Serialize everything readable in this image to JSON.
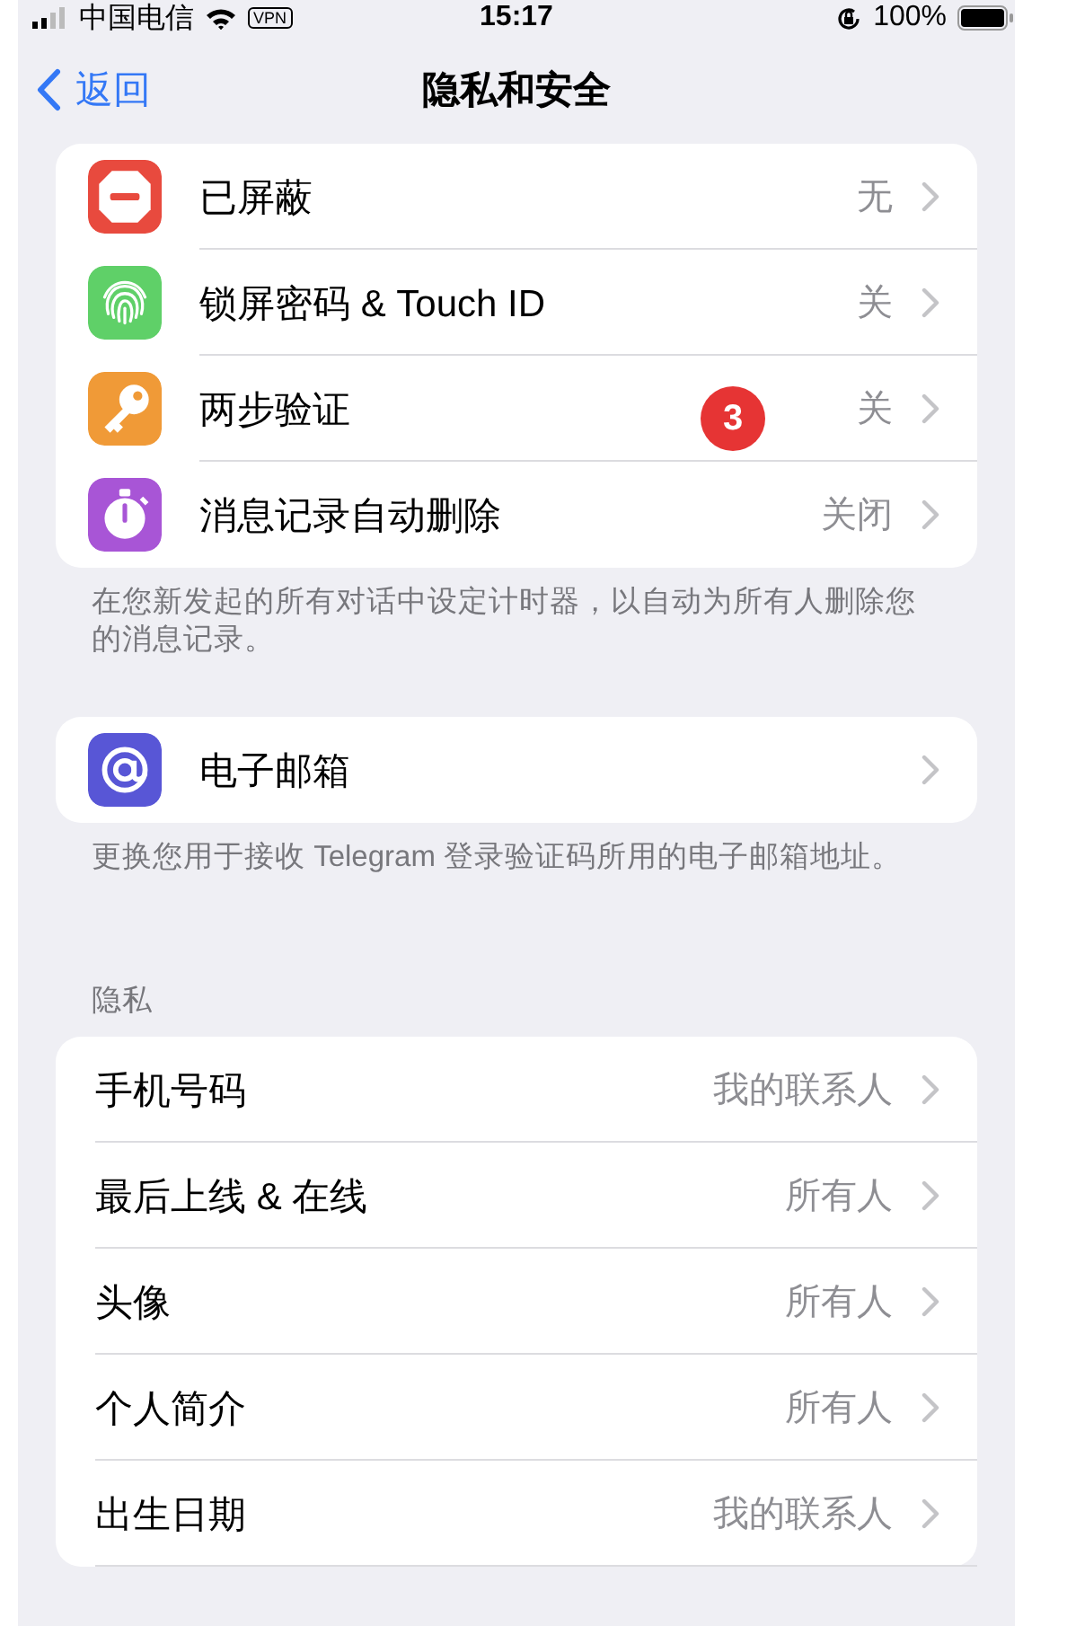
{
  "status_bar": {
    "carrier": "中国电信",
    "vpn": "VPN",
    "time": "15:17",
    "battery": "100%"
  },
  "nav": {
    "back": "返回",
    "title": "隐私和安全"
  },
  "groups": [
    {
      "rows": [
        {
          "label": "已屏蔽",
          "value": "无",
          "color": "#e84a3e"
        },
        {
          "label": "锁屏密码 & Touch ID",
          "value": "关",
          "color": "#5fd068"
        },
        {
          "label": "两步验证",
          "value": "关",
          "color": "#f09a37",
          "badge": "3"
        },
        {
          "label": "消息记录自动删除",
          "value": "关闭",
          "color": "#a855d6"
        }
      ],
      "footer": "在您新发起的所有对话中设定计时器，以自动为所有人删除您的消息记录。"
    },
    {
      "rows": [
        {
          "label": "电子邮箱",
          "color": "#5856d6"
        }
      ],
      "footer": "更换您用于接收 Telegram 登录验证码所用的电子邮箱地址。"
    },
    {
      "header": "隐私",
      "rows": [
        {
          "label": "手机号码",
          "value": "我的联系人"
        },
        {
          "label": "最后上线 & 在线",
          "value": "所有人"
        },
        {
          "label": "头像",
          "value": "所有人"
        },
        {
          "label": "个人简介",
          "value": "所有人"
        },
        {
          "label": "出生日期",
          "value": "我的联系人"
        }
      ]
    }
  ]
}
